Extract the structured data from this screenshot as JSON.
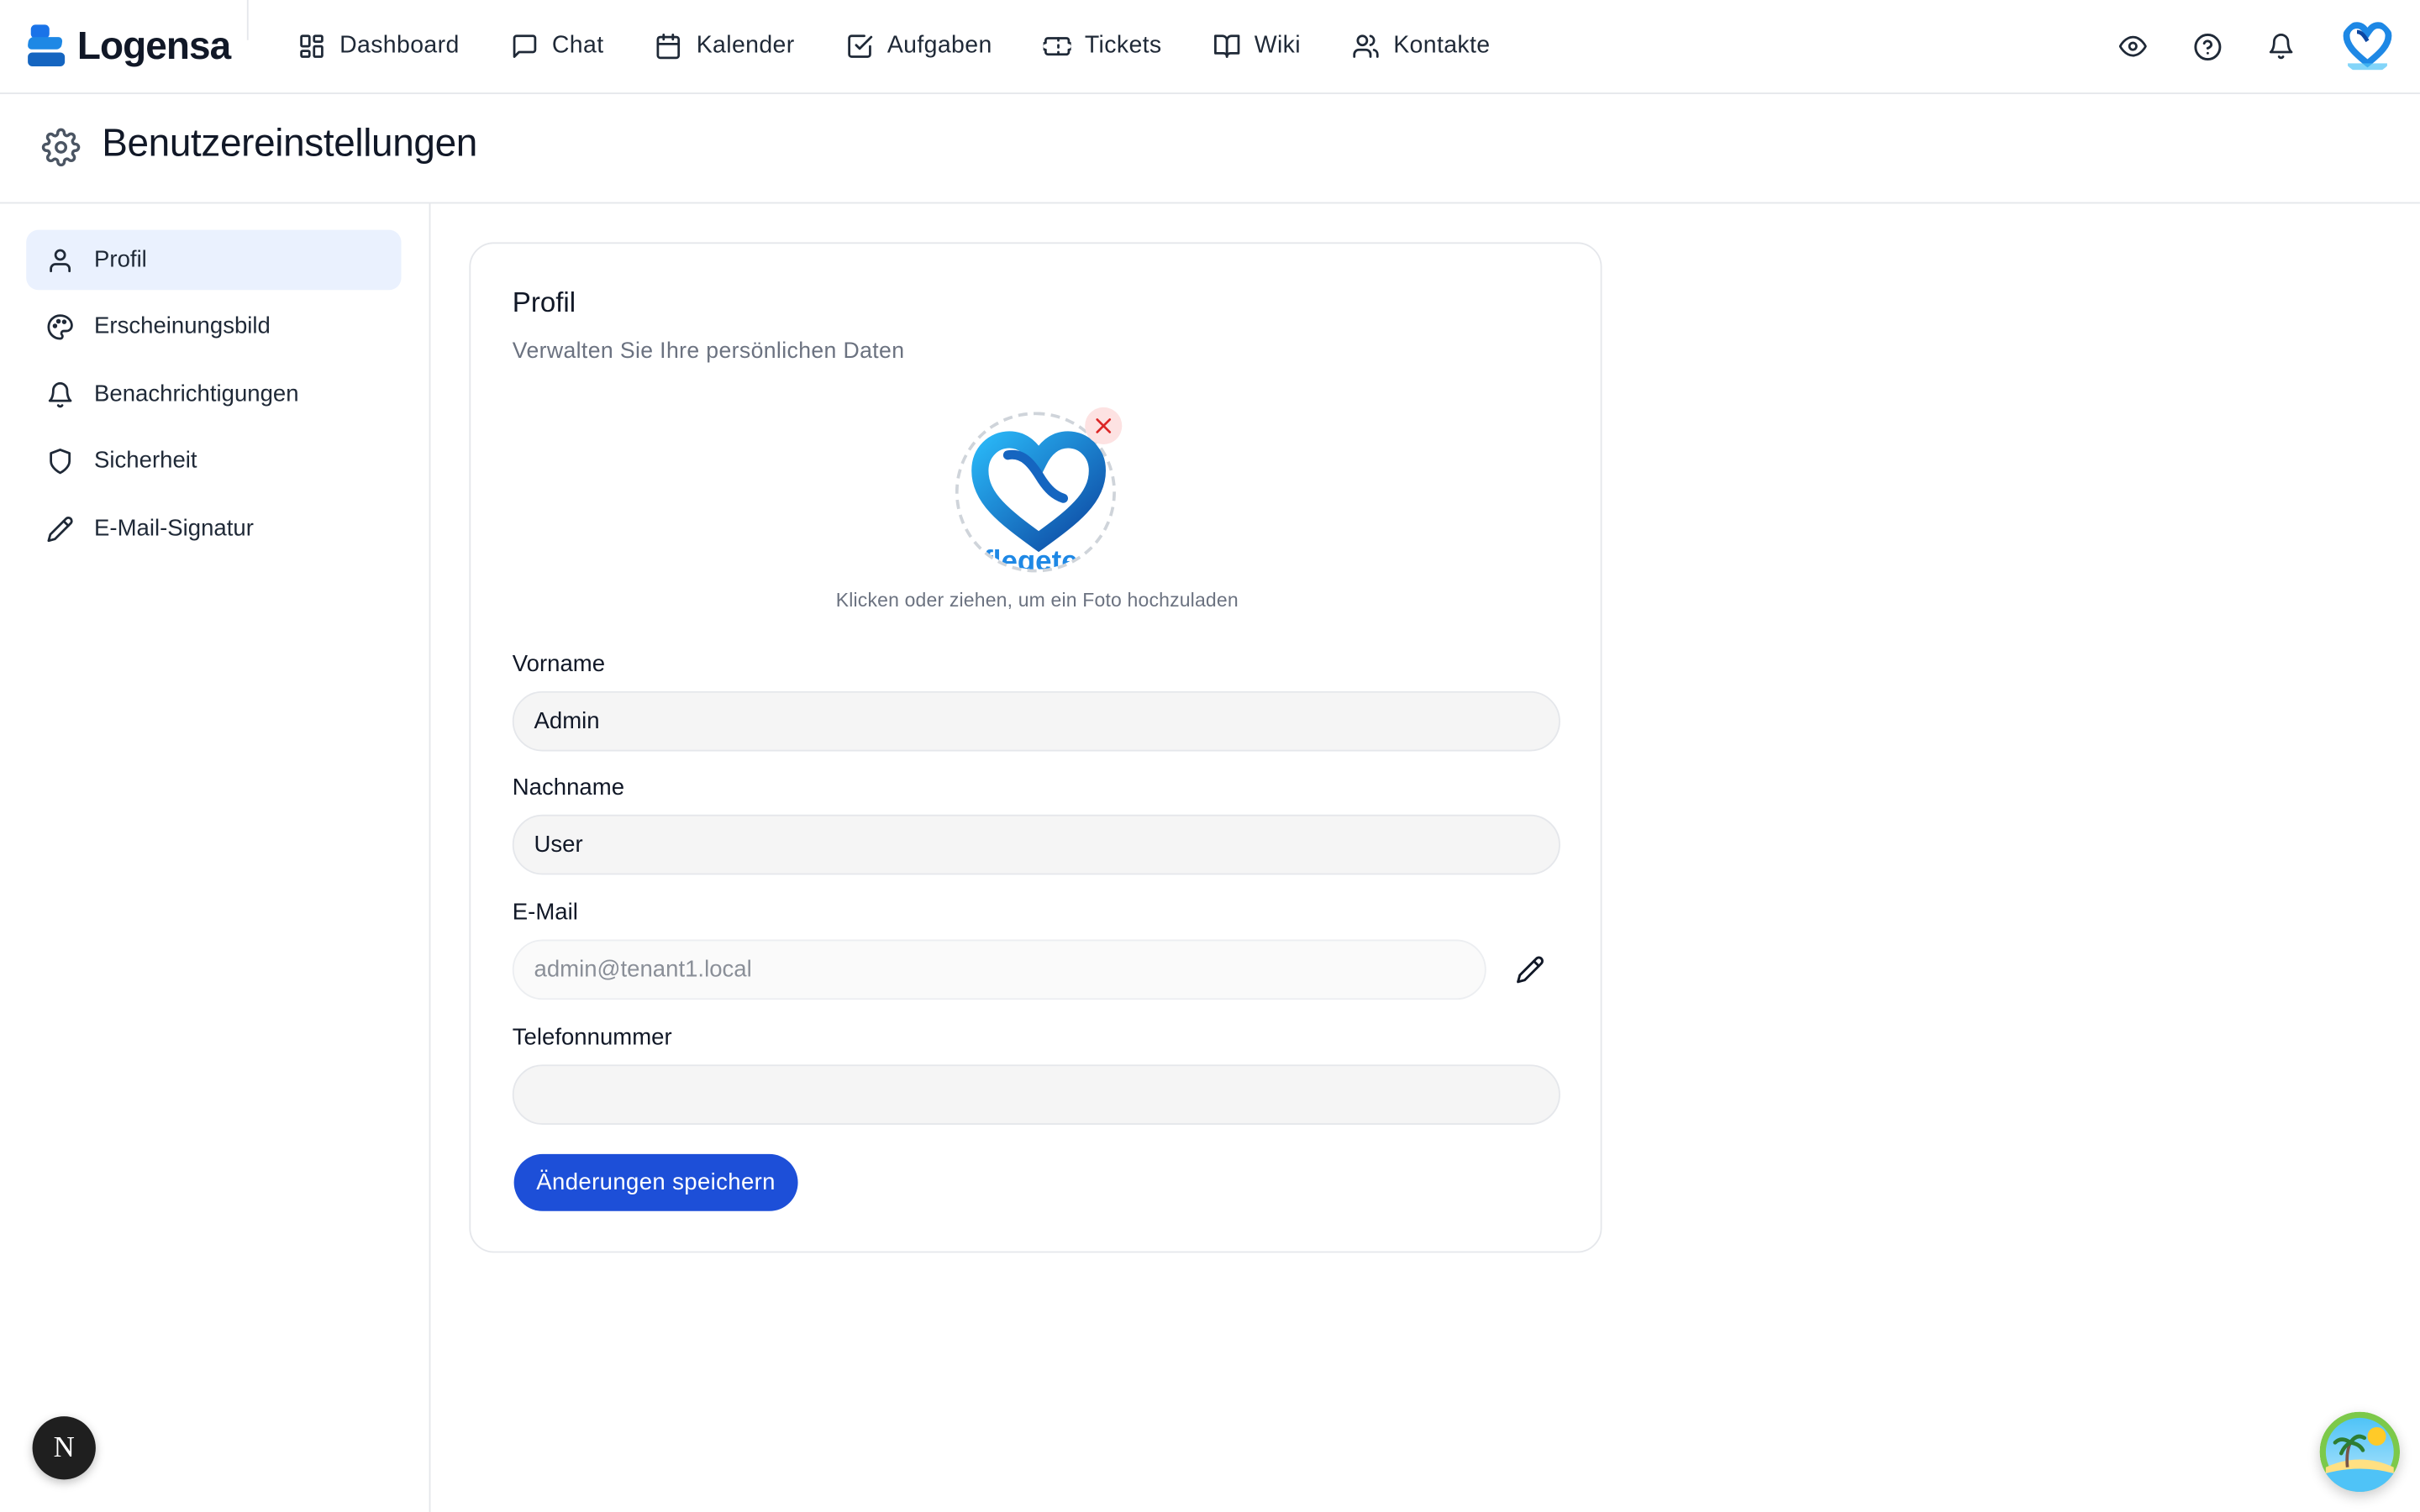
{
  "brand": {
    "name": "Logensa"
  },
  "nav": [
    {
      "label": "Dashboard",
      "icon": "dashboard-icon"
    },
    {
      "label": "Chat",
      "icon": "chat-icon"
    },
    {
      "label": "Kalender",
      "icon": "calendar-icon"
    },
    {
      "label": "Aufgaben",
      "icon": "task-icon"
    },
    {
      "label": "Tickets",
      "icon": "ticket-icon"
    },
    {
      "label": "Wiki",
      "icon": "book-icon"
    },
    {
      "label": "Kontakte",
      "icon": "contacts-icon"
    }
  ],
  "top_actions": [
    "eye-icon",
    "help-icon",
    "bell-icon",
    "user-avatar"
  ],
  "page": {
    "title": "Benutzereinstellungen",
    "icon": "gear-icon"
  },
  "sidebar": {
    "items": [
      {
        "label": "Profil",
        "icon": "user-icon",
        "active": true
      },
      {
        "label": "Erscheinungsbild",
        "icon": "palette-icon",
        "active": false
      },
      {
        "label": "Benachrichtigungen",
        "icon": "bell-icon",
        "active": false
      },
      {
        "label": "Sicherheit",
        "icon": "shield-icon",
        "active": false
      },
      {
        "label": "E-Mail-Signatur",
        "icon": "pen-icon",
        "active": false
      }
    ]
  },
  "profile": {
    "title": "Profil",
    "subtitle": "Verwalten Sie Ihre persönlichen Daten",
    "upload_hint": "Klicken oder ziehen, um ein Foto hochzuladen",
    "fields": {
      "first_name": {
        "label": "Vorname",
        "value": "Admin"
      },
      "last_name": {
        "label": "Nachname",
        "value": "User"
      },
      "email": {
        "label": "E-Mail",
        "value": "admin@tenant1.local"
      },
      "phone": {
        "label": "Telefonnummer",
        "value": ""
      }
    },
    "save_label": "Änderungen speichern"
  },
  "dev_badge": {
    "label": "N"
  },
  "colors": {
    "accent": "#1d4fd8",
    "active_bg": "#eaf1fe",
    "logo_blue": "#1e88e5",
    "danger": "#dc2626"
  }
}
